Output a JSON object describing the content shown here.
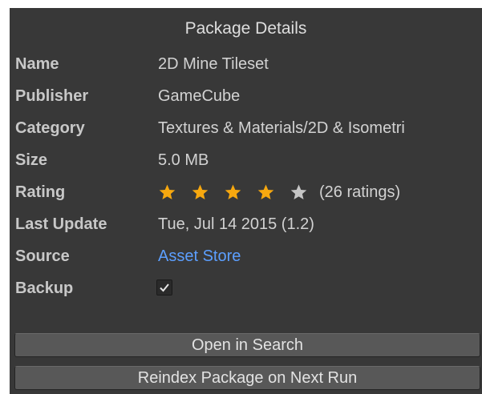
{
  "panel": {
    "title": "Package Details"
  },
  "details": {
    "name": {
      "label": "Name",
      "value": "2D Mine Tileset"
    },
    "publisher": {
      "label": "Publisher",
      "value": "GameCube"
    },
    "category": {
      "label": "Category",
      "value": "Textures & Materials/2D & Isometri"
    },
    "size": {
      "label": "Size",
      "value": "5.0 MB"
    },
    "rating": {
      "label": "Rating",
      "stars_filled": 4,
      "stars_total": 5,
      "count_text": "(26 ratings)",
      "filled_color": "#f7a80f",
      "empty_color": "#c6c6c6"
    },
    "last_update": {
      "label": "Last Update",
      "value": "Tue, Jul 14 2015 (1.2)"
    },
    "source": {
      "label": "Source",
      "value": "Asset Store",
      "link_color": "#5c9fff"
    },
    "backup": {
      "label": "Backup",
      "checked": true
    }
  },
  "buttons": {
    "open_in_search": "Open in Search",
    "reindex": "Reindex Package on Next Run"
  }
}
